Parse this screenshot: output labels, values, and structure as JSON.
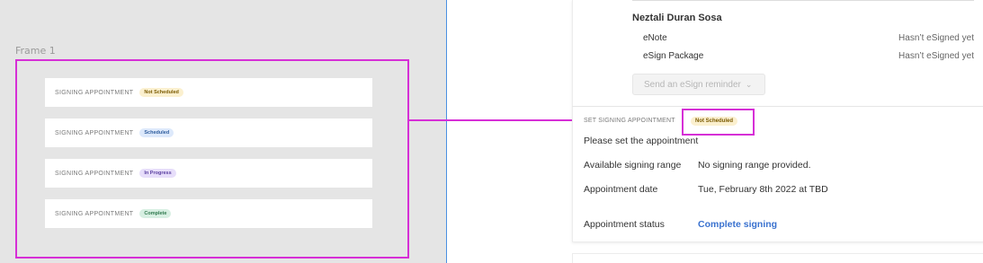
{
  "canvas": {
    "frame_label": "Frame 1",
    "variants": [
      {
        "label": "SIGNING APPOINTMENT",
        "badge": "Not Scheduled"
      },
      {
        "label": "SIGNING APPOINTMENT",
        "badge": "Scheduled"
      },
      {
        "label": "SIGNING APPOINTMENT",
        "badge": "In Progress"
      },
      {
        "label": "SIGNING APPOINTMENT",
        "badge": "Complete"
      }
    ]
  },
  "panel": {
    "signer_name": "Neztali Duran Sosa",
    "documents": [
      {
        "name": "eNote",
        "status": "Hasn’t eSigned yet"
      },
      {
        "name": "eSign Package",
        "status": "Hasn’t eSigned yet"
      }
    ],
    "reminder_button": "Send an eSign reminder",
    "set_section": {
      "title": "SET SIGNING APPOINTMENT",
      "badge": "Not Scheduled",
      "prompt": "Please set the appointment"
    },
    "rows": {
      "range_label": "Available signing range",
      "range_value": "No signing range provided.",
      "date_label": "Appointment date",
      "date_value": "Tue, February 8th 2022 at TBD",
      "status_label": "Appointment status",
      "status_value": "Complete signing"
    }
  },
  "colors": {
    "selection_outline": "#d62fd6",
    "link": "#3a72cf",
    "divider": "#4a90e2"
  }
}
